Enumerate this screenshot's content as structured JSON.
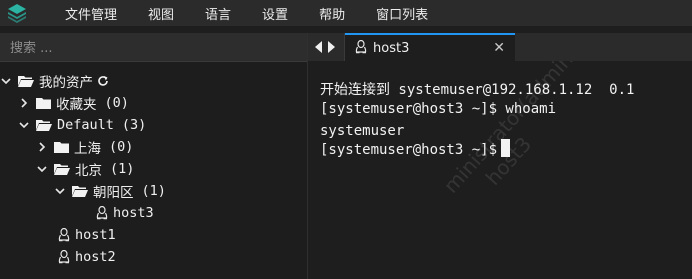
{
  "menubar": {
    "items": [
      "文件管理",
      "视图",
      "语言",
      "设置",
      "帮助",
      "窗口列表"
    ]
  },
  "sidebar": {
    "search_placeholder": "搜索 ...",
    "tree": {
      "root_label": "我的资产",
      "favorites": {
        "label": "收藏夹",
        "count": "(0)"
      },
      "default": {
        "label": "Default",
        "count": "(3)"
      },
      "shanghai": {
        "label": "上海",
        "count": "(0)"
      },
      "beijing": {
        "label": "北京",
        "count": "(1)"
      },
      "chaoyang": {
        "label": "朝阳区",
        "count": "(1)"
      },
      "host3": {
        "label": "host3"
      },
      "host1": {
        "label": "host1"
      },
      "host2": {
        "label": "host2"
      }
    }
  },
  "tabs": [
    {
      "label": "host3",
      "active": true
    }
  ],
  "terminal": {
    "lines": [
      "开始连接到 systemuser@192.168.1.12  0.1",
      "[systemuser@host3 ~]$ whoami",
      "systemuser",
      "[systemuser@host3 ~]$"
    ],
    "watermark": [
      "ministrator(admin)",
      "host3"
    ]
  },
  "colors": {
    "accent": "#2196f3",
    "logo": "#2bb3a3"
  }
}
